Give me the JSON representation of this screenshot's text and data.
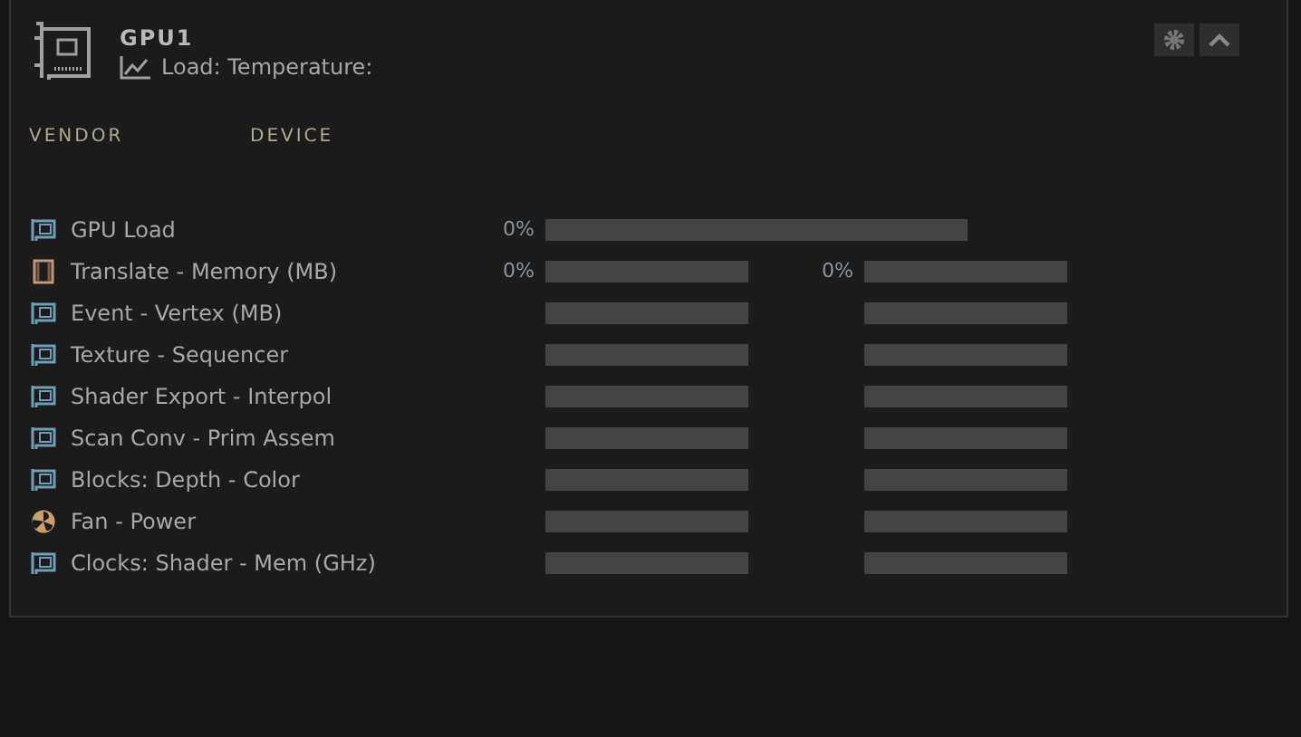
{
  "device": {
    "name": "GPU1",
    "summary": "Load: Temperature:"
  },
  "columns": [
    "VENDOR",
    "DEVICE"
  ],
  "rows": [
    {
      "kind": "card",
      "label": "GPU Load",
      "bars": [
        {
          "reading": "0%",
          "level": 0
        }
      ]
    },
    {
      "kind": "memory",
      "label": "Translate - Memory (MB)",
      "bars": [
        {
          "reading": "0%",
          "level": 0
        },
        {
          "reading": "0%",
          "level": 0
        }
      ]
    },
    {
      "kind": "card",
      "label": "Event - Vertex (MB)",
      "bars": [
        {
          "level": 0
        },
        {
          "level": 0
        }
      ]
    },
    {
      "kind": "card",
      "label": "Texture - Sequencer",
      "bars": [
        {
          "level": 0
        },
        {
          "level": 0
        }
      ]
    },
    {
      "kind": "card",
      "label": "Shader Export - Interpol",
      "bars": [
        {
          "level": 0
        },
        {
          "level": 0
        }
      ]
    },
    {
      "kind": "card",
      "label": "Scan Conv - Prim Assem",
      "bars": [
        {
          "level": 0
        },
        {
          "level": 0
        }
      ]
    },
    {
      "kind": "card",
      "label": "Blocks: Depth - Color",
      "bars": [
        {
          "level": 0
        },
        {
          "level": 0
        }
      ]
    },
    {
      "kind": "fan",
      "label": "Fan - Power",
      "bars": [
        {
          "level": 0
        },
        {
          "level": 0
        }
      ]
    },
    {
      "kind": "card",
      "label": "Clocks: Shader - Mem (GHz)",
      "bars": [
        {
          "level": 0
        },
        {
          "level": 0
        }
      ]
    }
  ]
}
